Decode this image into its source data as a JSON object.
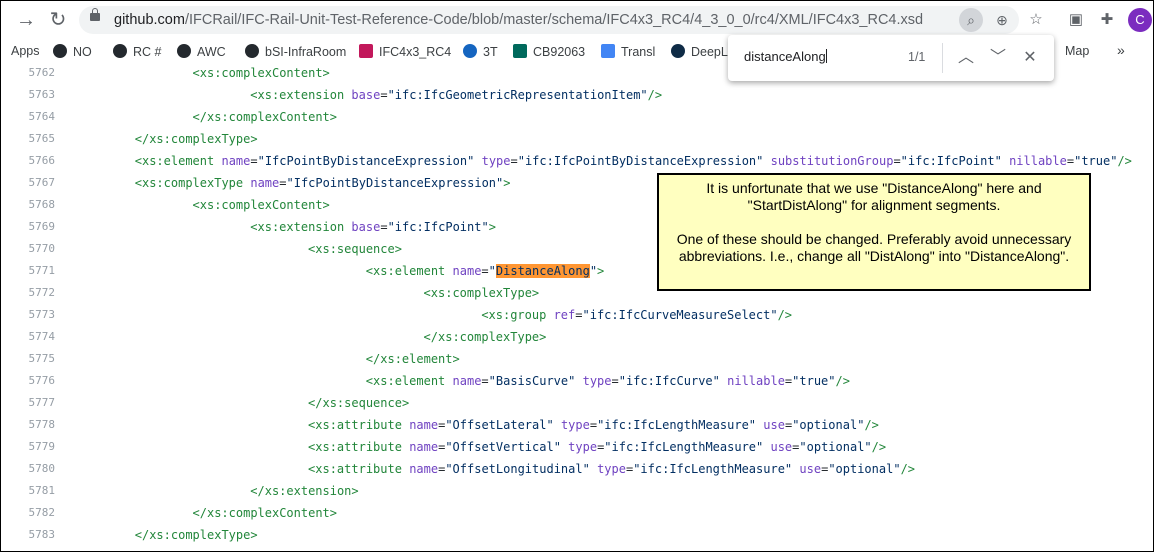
{
  "browser": {
    "url_host": "github.com",
    "url_path": "/IFCRail/IFC-Rail-Unit-Test-Reference-Code/blob/master/schema/IFC4x3_RC4/4_3_0_0/rc4/XML/IFC4x3_RC4.xsd",
    "avatar_letter": "C"
  },
  "bookmarks": [
    {
      "label": "Apps",
      "icon": "apps-icon"
    },
    {
      "label": "NO",
      "icon": "diamond-icon"
    },
    {
      "label": "RC #",
      "icon": "github-icon"
    },
    {
      "label": "AWC",
      "icon": "github-icon"
    },
    {
      "label": "bSI-InfraRoom",
      "icon": "github-icon"
    },
    {
      "label": "IFC4x3_RC4",
      "icon": "ifc-icon"
    },
    {
      "label": "3T",
      "icon": "dots-icon"
    },
    {
      "label": "CB92063",
      "icon": "dnb-icon"
    },
    {
      "label": "Transl",
      "icon": "translate-icon"
    },
    {
      "label": "DeepL",
      "icon": "deepl-icon"
    },
    {
      "label": "Map",
      "icon": "map-icon"
    }
  ],
  "find": {
    "query": "distanceAlong",
    "count": "1/1"
  },
  "code_lines": [
    {
      "n": "5762",
      "indent": 8,
      "parts": [
        [
          "tag",
          "<xs:complexContent>"
        ]
      ]
    },
    {
      "n": "5763",
      "indent": 12,
      "parts": [
        [
          "tag",
          "<xs:extension"
        ],
        [
          "t",
          " "
        ],
        [
          "attr",
          "base"
        ],
        [
          "t",
          "="
        ],
        [
          "str",
          "\"ifc:IfcGeometricRepresentationItem\""
        ],
        [
          "tag",
          "/>"
        ]
      ]
    },
    {
      "n": "5764",
      "indent": 8,
      "parts": [
        [
          "tag",
          "</xs:complexContent>"
        ]
      ]
    },
    {
      "n": "5765",
      "indent": 4,
      "parts": [
        [
          "tag",
          "</xs:complexType>"
        ]
      ]
    },
    {
      "n": "5766",
      "indent": 4,
      "parts": [
        [
          "tag",
          "<xs:element"
        ],
        [
          "t",
          " "
        ],
        [
          "attr",
          "name"
        ],
        [
          "t",
          "="
        ],
        [
          "str",
          "\"IfcPointByDistanceExpression\""
        ],
        [
          "t",
          " "
        ],
        [
          "attr",
          "type"
        ],
        [
          "t",
          "="
        ],
        [
          "str",
          "\"ifc:IfcPointByDistanceExpression\""
        ],
        [
          "t",
          " "
        ],
        [
          "attr",
          "substitutionGroup"
        ],
        [
          "t",
          "="
        ],
        [
          "str",
          "\"ifc:IfcPoint\""
        ],
        [
          "t",
          " "
        ],
        [
          "attr",
          "nillable"
        ],
        [
          "t",
          "="
        ],
        [
          "str",
          "\"true\""
        ],
        [
          "tag",
          "/>"
        ]
      ]
    },
    {
      "n": "5767",
      "indent": 4,
      "parts": [
        [
          "tag",
          "<xs:complexType"
        ],
        [
          "t",
          " "
        ],
        [
          "attr",
          "name"
        ],
        [
          "t",
          "="
        ],
        [
          "str",
          "\"IfcPointByDistanceExpression\""
        ],
        [
          "tag",
          ">"
        ]
      ]
    },
    {
      "n": "5768",
      "indent": 8,
      "parts": [
        [
          "tag",
          "<xs:complexContent>"
        ]
      ]
    },
    {
      "n": "5769",
      "indent": 12,
      "parts": [
        [
          "tag",
          "<xs:extension"
        ],
        [
          "t",
          " "
        ],
        [
          "attr",
          "base"
        ],
        [
          "t",
          "="
        ],
        [
          "str",
          "\"ifc:IfcPoint\""
        ],
        [
          "tag",
          ">"
        ]
      ]
    },
    {
      "n": "5770",
      "indent": 16,
      "parts": [
        [
          "tag",
          "<xs:sequence>"
        ]
      ]
    },
    {
      "n": "5771",
      "indent": 20,
      "parts": [
        [
          "tag",
          "<xs:element"
        ],
        [
          "t",
          " "
        ],
        [
          "attr",
          "name"
        ],
        [
          "t",
          "="
        ],
        [
          "str",
          "\""
        ],
        [
          "hl",
          "DistanceAlong"
        ],
        [
          "str",
          "\""
        ],
        [
          "tag",
          ">"
        ]
      ]
    },
    {
      "n": "5772",
      "indent": 24,
      "parts": [
        [
          "tag",
          "<xs:complexType>"
        ]
      ]
    },
    {
      "n": "5773",
      "indent": 28,
      "parts": [
        [
          "tag",
          "<xs:group"
        ],
        [
          "t",
          " "
        ],
        [
          "attr",
          "ref"
        ],
        [
          "t",
          "="
        ],
        [
          "str",
          "\"ifc:IfcCurveMeasureSelect\""
        ],
        [
          "tag",
          "/>"
        ]
      ]
    },
    {
      "n": "5774",
      "indent": 24,
      "parts": [
        [
          "tag",
          "</xs:complexType>"
        ]
      ]
    },
    {
      "n": "5775",
      "indent": 20,
      "parts": [
        [
          "tag",
          "</xs:element>"
        ]
      ]
    },
    {
      "n": "5776",
      "indent": 20,
      "parts": [
        [
          "tag",
          "<xs:element"
        ],
        [
          "t",
          " "
        ],
        [
          "attr",
          "name"
        ],
        [
          "t",
          "="
        ],
        [
          "str",
          "\"BasisCurve\""
        ],
        [
          "t",
          " "
        ],
        [
          "attr",
          "type"
        ],
        [
          "t",
          "="
        ],
        [
          "str",
          "\"ifc:IfcCurve\""
        ],
        [
          "t",
          " "
        ],
        [
          "attr",
          "nillable"
        ],
        [
          "t",
          "="
        ],
        [
          "str",
          "\"true\""
        ],
        [
          "tag",
          "/>"
        ]
      ]
    },
    {
      "n": "5777",
      "indent": 16,
      "parts": [
        [
          "tag",
          "</xs:sequence>"
        ]
      ]
    },
    {
      "n": "5778",
      "indent": 16,
      "parts": [
        [
          "tag",
          "<xs:attribute"
        ],
        [
          "t",
          " "
        ],
        [
          "attr",
          "name"
        ],
        [
          "t",
          "="
        ],
        [
          "str",
          "\"OffsetLateral\""
        ],
        [
          "t",
          " "
        ],
        [
          "attr",
          "type"
        ],
        [
          "t",
          "="
        ],
        [
          "str",
          "\"ifc:IfcLengthMeasure\""
        ],
        [
          "t",
          " "
        ],
        [
          "attr",
          "use"
        ],
        [
          "t",
          "="
        ],
        [
          "str",
          "\"optional\""
        ],
        [
          "tag",
          "/>"
        ]
      ]
    },
    {
      "n": "5779",
      "indent": 16,
      "parts": [
        [
          "tag",
          "<xs:attribute"
        ],
        [
          "t",
          " "
        ],
        [
          "attr",
          "name"
        ],
        [
          "t",
          "="
        ],
        [
          "str",
          "\"OffsetVertical\""
        ],
        [
          "t",
          " "
        ],
        [
          "attr",
          "type"
        ],
        [
          "t",
          "="
        ],
        [
          "str",
          "\"ifc:IfcLengthMeasure\""
        ],
        [
          "t",
          " "
        ],
        [
          "attr",
          "use"
        ],
        [
          "t",
          "="
        ],
        [
          "str",
          "\"optional\""
        ],
        [
          "tag",
          "/>"
        ]
      ]
    },
    {
      "n": "5780",
      "indent": 16,
      "parts": [
        [
          "tag",
          "<xs:attribute"
        ],
        [
          "t",
          " "
        ],
        [
          "attr",
          "name"
        ],
        [
          "t",
          "="
        ],
        [
          "str",
          "\"OffsetLongitudinal\""
        ],
        [
          "t",
          " "
        ],
        [
          "attr",
          "type"
        ],
        [
          "t",
          "="
        ],
        [
          "str",
          "\"ifc:IfcLengthMeasure\""
        ],
        [
          "t",
          " "
        ],
        [
          "attr",
          "use"
        ],
        [
          "t",
          "="
        ],
        [
          "str",
          "\"optional\""
        ],
        [
          "tag",
          "/>"
        ]
      ]
    },
    {
      "n": "5781",
      "indent": 12,
      "parts": [
        [
          "tag",
          "</xs:extension>"
        ]
      ]
    },
    {
      "n": "5782",
      "indent": 8,
      "parts": [
        [
          "tag",
          "</xs:complexContent>"
        ]
      ]
    },
    {
      "n": "5783",
      "indent": 4,
      "parts": [
        [
          "tag",
          "</xs:complexType>"
        ]
      ]
    }
  ],
  "note": {
    "paragraph1": "It is unfortunate that we use \"DistanceAlong\" here and \"StartDistAlong\" for alignment segments.",
    "paragraph2": "One of these should be changed. Preferably avoid unnecessary abbreviations. I.e., change all \"DistAlong\" into \"DistanceAlong\"."
  }
}
